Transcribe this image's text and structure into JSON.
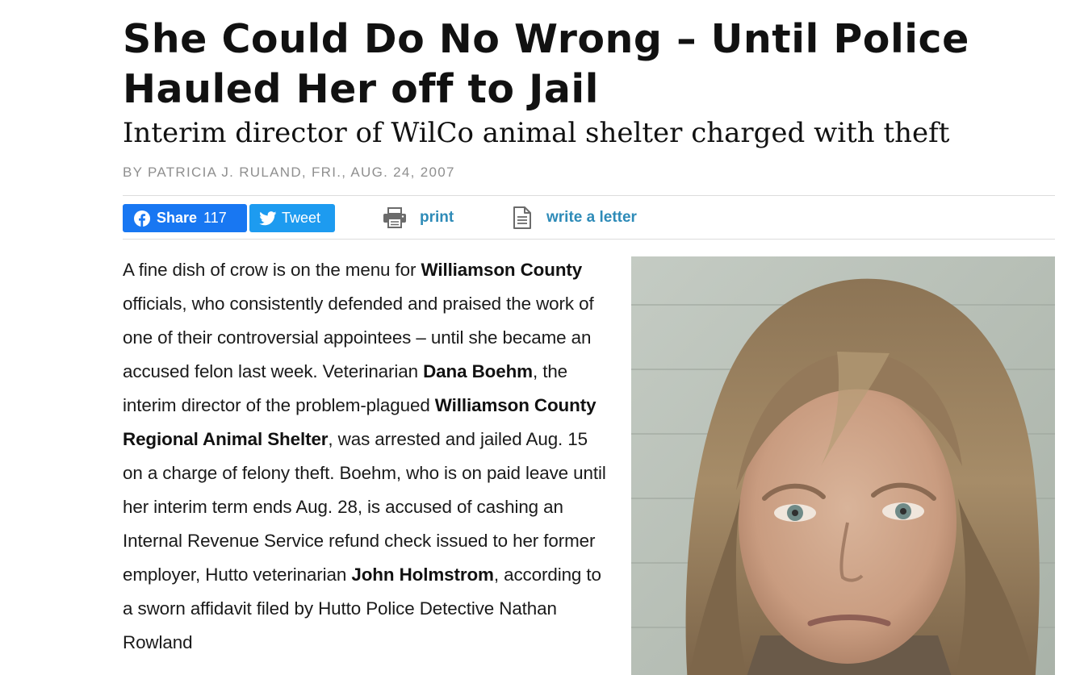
{
  "article": {
    "headline": "She Could Do No Wrong – Until Police Hauled Her off to Jail",
    "subhead": "Interim director of WilCo animal shelter charged with theft",
    "byline": "BY PATRICIA J. RULAND, FRI., AUG. 24, 2007"
  },
  "share": {
    "facebook_label": "Share",
    "facebook_count": "117",
    "tweet_label": "Tweet",
    "print_label": "print",
    "letter_label": "write a letter"
  },
  "body": {
    "segments": [
      {
        "t": "A fine dish of crow is on the menu for ",
        "b": false
      },
      {
        "t": "Williamson County",
        "b": true
      },
      {
        "t": " officials, who consistently defended and praised the work of one of their controversial appointees – until she became an accused felon last week. Veterinarian ",
        "b": false
      },
      {
        "t": "Dana Boehm",
        "b": true
      },
      {
        "t": ", the interim director of the problem-plagued ",
        "b": false
      },
      {
        "t": "Williamson County Regional Animal Shelter",
        "b": true
      },
      {
        "t": ", was arrested and jailed Aug. 15 on a charge of felony theft. Boehm, who is on paid leave until her interim term ends Aug. 28, is accused of cashing an Internal Revenue Service refund check issued to her former employer, Hutto veterinarian ",
        "b": false
      },
      {
        "t": "John Holmstrom",
        "b": true
      },
      {
        "t": ", according to a sworn affidavit filed by Hutto Police Detective Nathan Rowland",
        "b": false
      }
    ]
  },
  "colors": {
    "facebook": "#1877f2",
    "twitter": "#1d9bf0",
    "link": "#2e8bb8",
    "byline": "#8f8f8f"
  },
  "icons": {
    "facebook": "facebook-icon",
    "twitter": "twitter-icon",
    "print": "printer-icon",
    "letter": "document-icon"
  }
}
